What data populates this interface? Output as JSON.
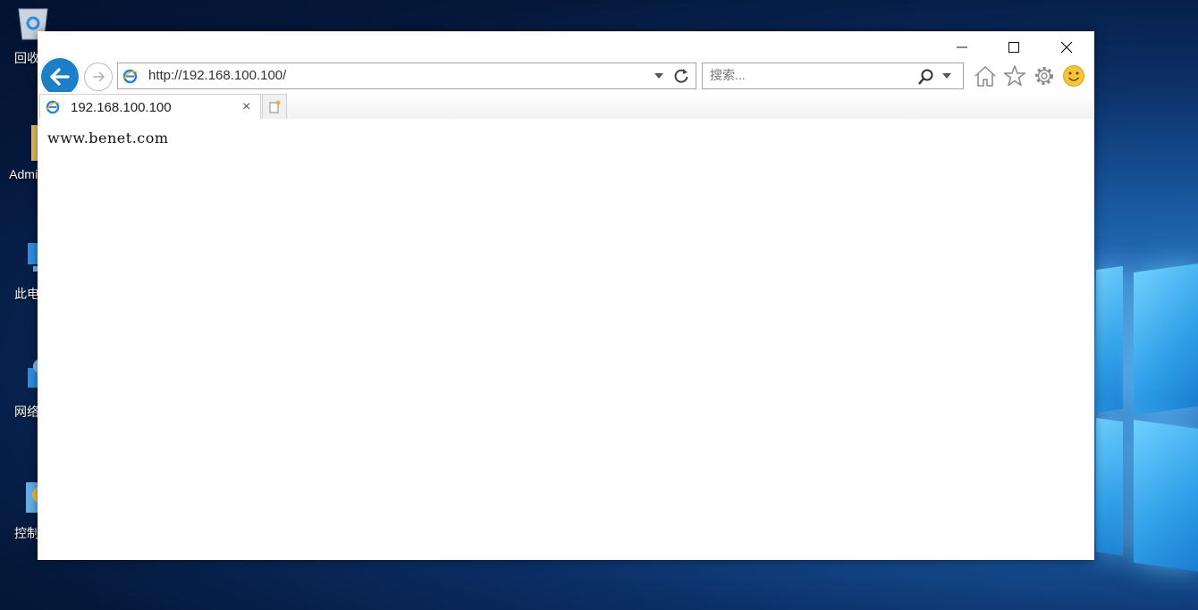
{
  "desktop": {
    "icons": [
      {
        "label": "回收"
      },
      {
        "label": "Admin"
      },
      {
        "label": "此电"
      },
      {
        "label": "网络"
      },
      {
        "label": "控制"
      }
    ]
  },
  "browser": {
    "address": "http://192.168.100.100/",
    "search_placeholder": "搜索...",
    "tab_title": "192.168.100.100",
    "tab_close": "×",
    "page_text": "www.benet.com"
  },
  "colors": {
    "accent": "#1d7fc7",
    "desktop_bg": "#0b2f66"
  },
  "icons": [
    "back-arrow-icon",
    "forward-arrow-icon",
    "ie-logo-icon",
    "refresh-icon",
    "search-icon",
    "home-icon",
    "star-icon",
    "gear-icon",
    "smiley-icon",
    "new-tab-icon",
    "minimize-icon",
    "maximize-icon",
    "close-icon"
  ]
}
